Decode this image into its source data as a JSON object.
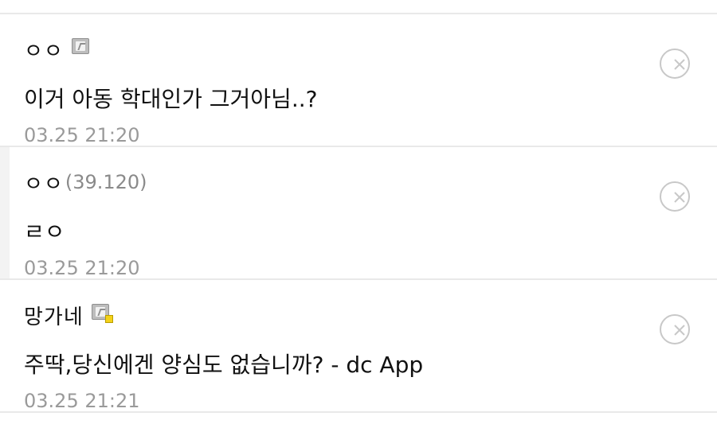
{
  "comments": [
    {
      "author": "ㅇㅇ",
      "ip": "",
      "text": "이거 아동 학대인가 그거아님..?",
      "time": "03.25 21:20",
      "delete_icon": "circle-x-icon"
    },
    {
      "author": "ㅇㅇ",
      "ip": "(39.120)",
      "text": "ㄹㅇ",
      "time": "03.25 21:20",
      "delete_icon": "circle-x-icon"
    },
    {
      "author": "망가네",
      "ip": "",
      "text": "주딱,당신에겐 양심도 없습니까? - dc App",
      "time": "03.25 21:21",
      "delete_icon": "circle-x-icon"
    }
  ],
  "colors": {
    "divider": "#e9e9e9",
    "meta_text": "#9a9a9a",
    "ip_text": "#8a8a8a",
    "badge_gold": "#f4d21a"
  }
}
